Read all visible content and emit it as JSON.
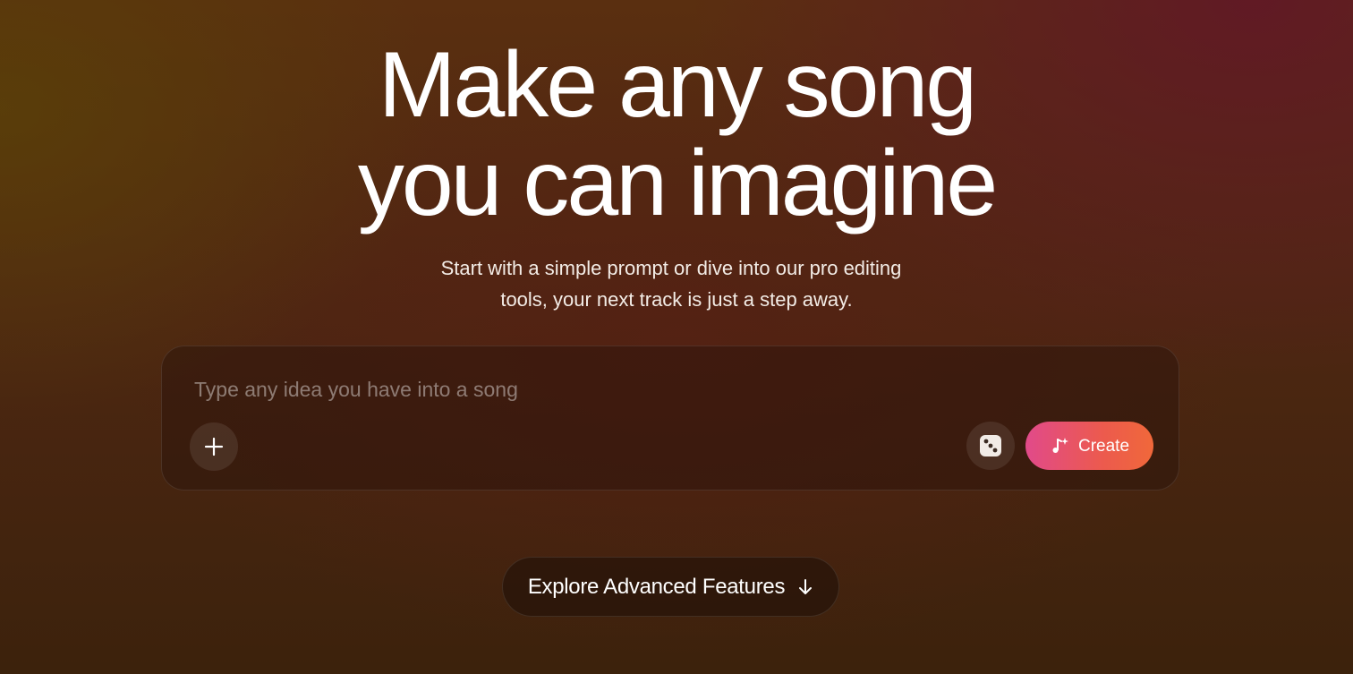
{
  "hero": {
    "headline_line1": "Make any song",
    "headline_line2": "you can imagine",
    "subtitle_line1": "Start with a simple prompt or dive into our pro editing",
    "subtitle_line2": "tools, your next track is just a step away."
  },
  "prompt": {
    "placeholder": "Type any idea you have into a song",
    "value": "",
    "add_icon": "plus-icon",
    "random_icon": "dice-icon",
    "create_icon": "music-note-sparkle-icon",
    "create_label": "Create",
    "create_gradient": [
      "#e14a8a",
      "#f0683a"
    ]
  },
  "explore": {
    "label": "Explore Advanced Features",
    "icon": "arrow-down-icon"
  },
  "colors": {
    "background_dark": "#3c220c",
    "background_red": "#621628",
    "text": "#ffffff"
  }
}
